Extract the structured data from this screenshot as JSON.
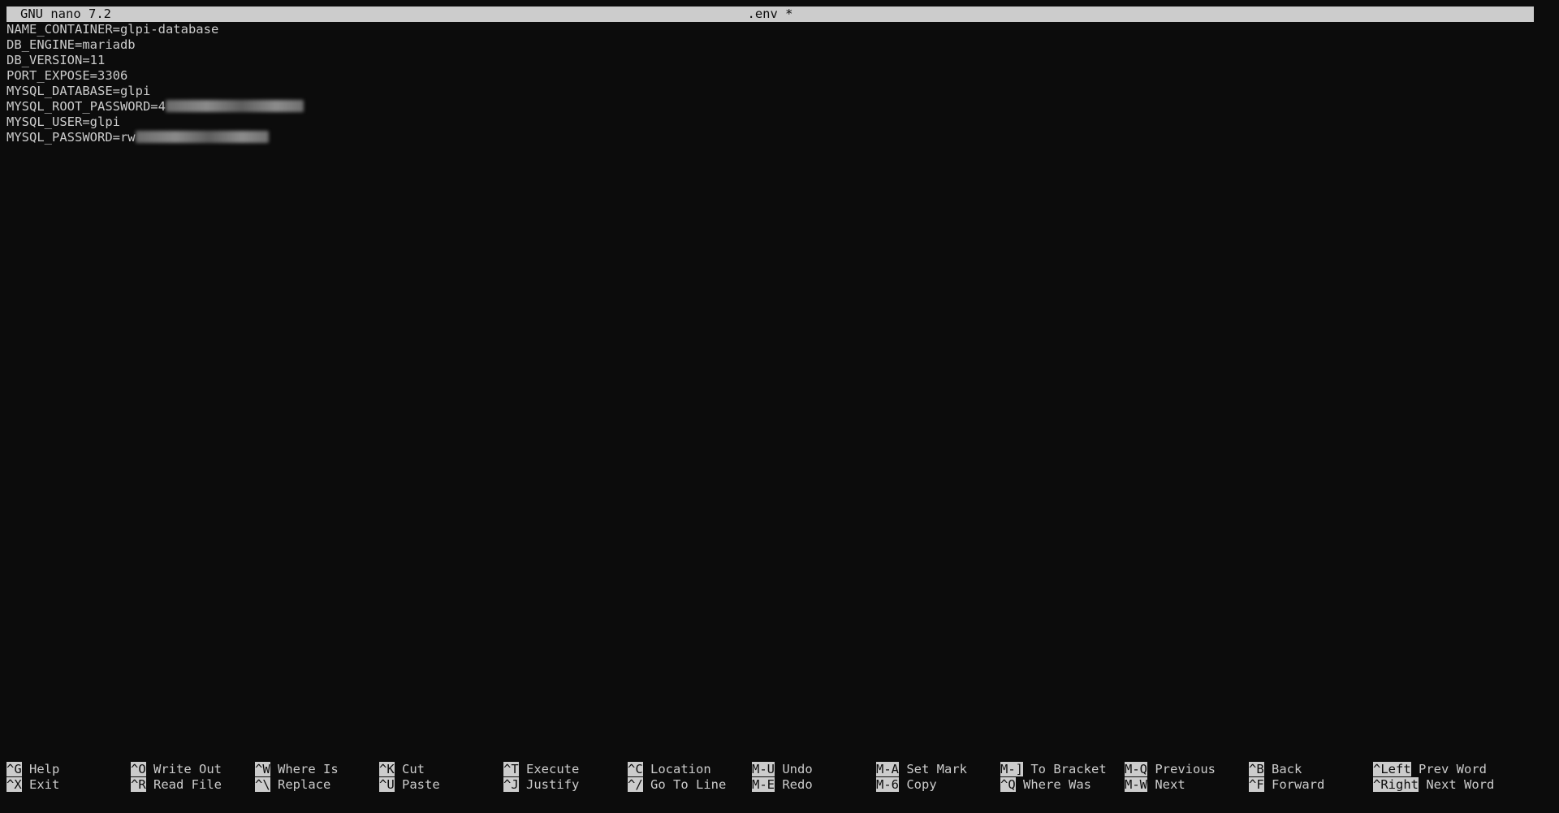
{
  "titlebar": {
    "app": "GNU nano 7.2",
    "file": ".env *"
  },
  "editor": {
    "lines": [
      "NAME_CONTAINER=glpi-database",
      "DB_ENGINE=mariadb",
      "DB_VERSION=11",
      "PORT_EXPOSE=3306",
      "MYSQL_DATABASE=glpi",
      "MYSQL_ROOT_PASSWORD=4",
      "MYSQL_USER=glpi",
      "MYSQL_PASSWORD=rw"
    ]
  },
  "shortcuts": {
    "row1": [
      {
        "key": "^G",
        "label": "Help"
      },
      {
        "key": "^O",
        "label": "Write Out"
      },
      {
        "key": "^W",
        "label": "Where Is"
      },
      {
        "key": "^K",
        "label": "Cut"
      },
      {
        "key": "^T",
        "label": "Execute"
      },
      {
        "key": "^C",
        "label": "Location"
      },
      {
        "key": "M-U",
        "label": "Undo"
      },
      {
        "key": "M-A",
        "label": "Set Mark"
      },
      {
        "key": "M-]",
        "label": "To Bracket"
      },
      {
        "key": "M-Q",
        "label": "Previous"
      },
      {
        "key": "^B",
        "label": "Back"
      },
      {
        "key": "^Left",
        "label": "Prev Word"
      }
    ],
    "row2": [
      {
        "key": "^X",
        "label": "Exit"
      },
      {
        "key": "^R",
        "label": "Read File"
      },
      {
        "key": "^\\",
        "label": "Replace"
      },
      {
        "key": "^U",
        "label": "Paste"
      },
      {
        "key": "^J",
        "label": "Justify"
      },
      {
        "key": "^/",
        "label": "Go To Line"
      },
      {
        "key": "M-E",
        "label": "Redo"
      },
      {
        "key": "M-6",
        "label": "Copy"
      },
      {
        "key": "^Q",
        "label": "Where Was"
      },
      {
        "key": "M-W",
        "label": "Next"
      },
      {
        "key": "^F",
        "label": "Forward"
      },
      {
        "key": "^Right",
        "label": "Next Word"
      }
    ]
  }
}
